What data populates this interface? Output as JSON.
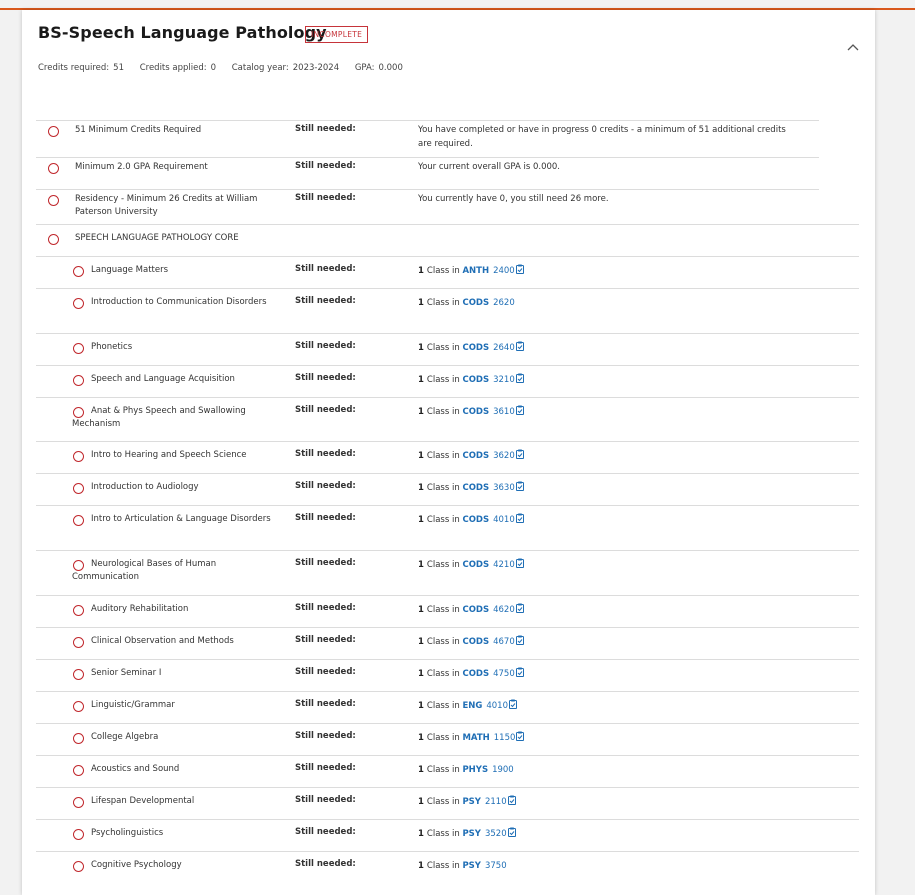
{
  "header": {
    "title": "BS-Speech Language Pathology",
    "status_badge": "INCOMPLETE",
    "credits_required_label": "Credits required:",
    "credits_required_value": "51",
    "credits_applied_label": "Credits applied:",
    "credits_applied_value": "0",
    "catalog_year_label": "Catalog year:",
    "catalog_year_value": "2023-2024",
    "gpa_label": "GPA:",
    "gpa_value": "0.000"
  },
  "colors": {
    "accent_line": "#d9581c",
    "incomplete_red": "#c0282d",
    "link_blue": "#1f6eb5"
  },
  "still_needed_label": "Still needed:",
  "class_in_label": "Class in",
  "requirements": [
    {
      "name": "51 Minimum Credits Required",
      "description": "You have completed or have in progress 0 credits - a minimum of 51 additional credits are required."
    },
    {
      "name": "Minimum 2.0 GPA Requirement",
      "description": "Your current overall GPA is 0.000."
    },
    {
      "name": "Residency - Minimum 26 Credits at William Paterson University",
      "description": "You currently have 0, you still need 26 more."
    }
  ],
  "section": {
    "name": "SPEECH LANGUAGE PATHOLOGY CORE"
  },
  "courses": [
    {
      "name": "Language Matters",
      "count": "1",
      "subject": "ANTH",
      "number": "2400",
      "icon": "clipboard-icon"
    },
    {
      "name": "Introduction to Communication Disorders",
      "count": "1",
      "subject": "CODS",
      "number": "2620",
      "icon": ""
    },
    {
      "name": "Phonetics",
      "count": "1",
      "subject": "CODS",
      "number": "2640",
      "icon": "clipboard-icon"
    },
    {
      "name": "Speech and Language Acquisition",
      "count": "1",
      "subject": "CODS",
      "number": "3210",
      "icon": "clipboard-icon"
    },
    {
      "name": "Anat & Phys Speech and Swallowing Mechanism",
      "count": "1",
      "subject": "CODS",
      "number": "3610",
      "icon": "clipboard-icon"
    },
    {
      "name": "Intro to Hearing and Speech Science",
      "count": "1",
      "subject": "CODS",
      "number": "3620",
      "icon": "clipboard-icon"
    },
    {
      "name": "Introduction to Audiology",
      "count": "1",
      "subject": "CODS",
      "number": "3630",
      "icon": "clipboard-icon"
    },
    {
      "name": "Intro to Articulation & Language Disorders",
      "count": "1",
      "subject": "CODS",
      "number": "4010",
      "icon": "clipboard-icon"
    },
    {
      "name": "Neurological Bases of Human Communication",
      "count": "1",
      "subject": "CODS",
      "number": "4210",
      "icon": "clipboard-icon"
    },
    {
      "name": "Auditory Rehabilitation",
      "count": "1",
      "subject": "CODS",
      "number": "4620",
      "icon": "clipboard-icon"
    },
    {
      "name": "Clinical Observation and Methods",
      "count": "1",
      "subject": "CODS",
      "number": "4670",
      "icon": "clipboard-icon"
    },
    {
      "name": "Senior Seminar I",
      "count": "1",
      "subject": "CODS",
      "number": "4750",
      "icon": "clipboard-icon"
    },
    {
      "name": "Linguistic/Grammar",
      "count": "1",
      "subject": "ENG",
      "number": "4010",
      "icon": "clipboard-icon"
    },
    {
      "name": "College Algebra",
      "count": "1",
      "subject": "MATH",
      "number": "1150",
      "icon": "clipboard-icon"
    },
    {
      "name": "Acoustics and Sound",
      "count": "1",
      "subject": "PHYS",
      "number": "1900",
      "icon": ""
    },
    {
      "name": "Lifespan Developmental",
      "count": "1",
      "subject": "PSY",
      "number": "2110",
      "icon": "clipboard-icon"
    },
    {
      "name": "Psycholinguistics",
      "count": "1",
      "subject": "PSY",
      "number": "3520",
      "icon": "clipboard-icon"
    },
    {
      "name": "Cognitive Psychology",
      "count": "1",
      "subject": "PSY",
      "number": "3750",
      "icon": ""
    }
  ]
}
